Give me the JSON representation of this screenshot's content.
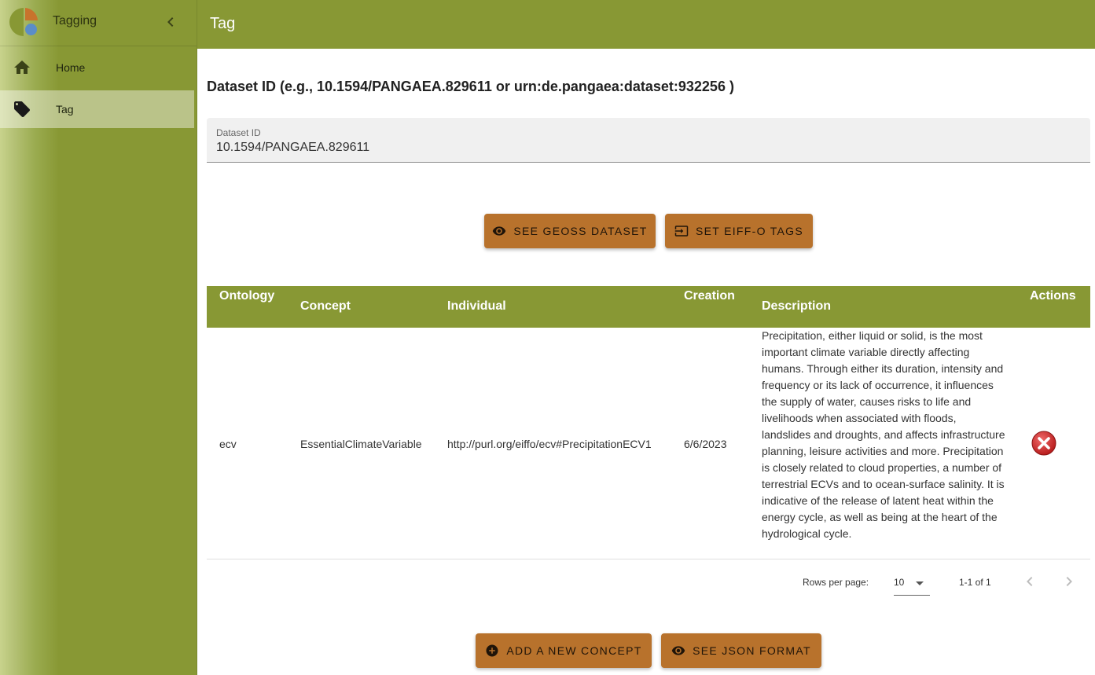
{
  "sidebar": {
    "app_title": "Tagging",
    "items": [
      {
        "label": "Home",
        "icon": "home-icon"
      },
      {
        "label": "Tag",
        "icon": "tag-icon",
        "active": true
      }
    ]
  },
  "appbar": {
    "title": "Tag"
  },
  "dataset": {
    "section_title": "Dataset ID (e.g., 10.1594/PANGAEA.829611 or urn:de.pangaea:dataset:932256 )",
    "field_label": "Dataset ID",
    "field_value": "10.1594/PANGAEA.829611"
  },
  "actions": {
    "see_geoss": "SEE GEOSS DATASET",
    "set_eiff": "SET EIFF-O TAGS",
    "add_concept": "ADD A NEW CONCEPT",
    "see_json": "SEE JSON FORMAT"
  },
  "table": {
    "headers": [
      "Ontology",
      "Concept",
      "Individual",
      "Creation",
      "Description",
      "Actions"
    ],
    "rows": [
      {
        "ontology": "ecv",
        "concept": "EssentialClimateVariable",
        "individual": "http://purl.org/eiffo/ecv#PrecipitationECV1",
        "creation": "6/6/2023",
        "description": "Precipitation, either liquid or solid, is the most important climate variable directly affecting humans. Through either its duration, intensity and frequency or its lack of occurrence, it influences the supply of water, causes risks to life and livelihoods when associated with floods, landslides and droughts, and affects infrastructure planning, leisure activities and more. Precipitation is closely related to cloud properties, a number of terrestrial ECVs and to ocean-surface salinity. It is indicative of the release of latent heat within the energy cycle, as well as being at the heart of the hydrological cycle."
      }
    ]
  },
  "pagination": {
    "rows_per_page_label": "Rows per page:",
    "rows_per_page": "10",
    "range": "1-1 of 1"
  },
  "colors": {
    "primary": "#889834",
    "accent_button": "#b8722c",
    "active_nav": "#b6c07e"
  }
}
